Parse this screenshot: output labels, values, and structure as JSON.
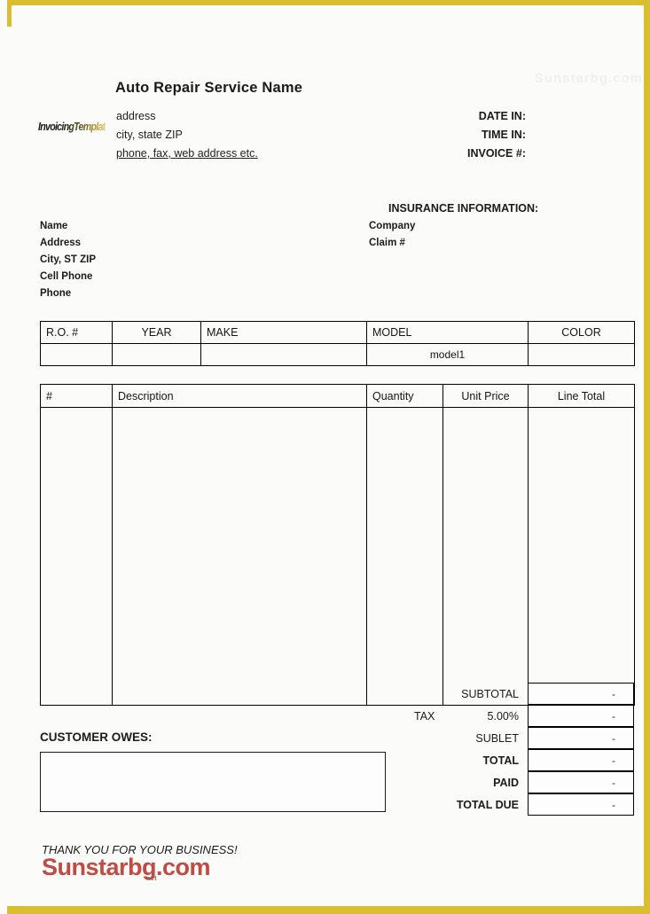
{
  "document": {
    "type": "auto-repair-invoice-template",
    "accent_border_color": "#d9bf2e",
    "watermark_color": "#b9382f",
    "page_background": "#fbfbfa"
  },
  "header": {
    "company_title": "Auto Repair Service Name",
    "brand_logo_text": "InvoicingTemplates",
    "address_line1": "address",
    "address_line2": "city, state ZIP",
    "address_line3": "phone, fax, web address etc.",
    "faint_watermark": "Sunstarbg.com",
    "meta": [
      {
        "label": "DATE IN:",
        "value": ""
      },
      {
        "label": "TIME IN:",
        "value": ""
      },
      {
        "label": "INVOICE #:",
        "value": ""
      }
    ]
  },
  "parties": {
    "customer_fields": [
      "Name",
      "Address",
      "City, ST ZIP",
      "Cell Phone",
      "Phone"
    ],
    "insurance_heading": "INSURANCE INFORMATION:",
    "insurance_fields": [
      "Company",
      "Claim #"
    ]
  },
  "vehicle_table": {
    "headers": [
      "R.O. #",
      "YEAR",
      "MAKE",
      "MODEL",
      "COLOR"
    ],
    "row": [
      "",
      "",
      "",
      "model1",
      ""
    ]
  },
  "items_table": {
    "headers": [
      "#",
      "Description",
      "Quantity",
      "Unit Price",
      "Line Total"
    ],
    "rows": []
  },
  "totals": [
    {
      "tax_label": "",
      "label": "SUBTOTAL",
      "value": "-",
      "bold": false
    },
    {
      "tax_label": "TAX",
      "label": "5.00%",
      "value": "-",
      "bold": false
    },
    {
      "tax_label": "",
      "label": "SUBLET",
      "value": "-",
      "bold": false
    },
    {
      "tax_label": "",
      "label": "TOTAL",
      "value": "-",
      "bold": true
    },
    {
      "tax_label": "",
      "label": "PAID",
      "value": "-",
      "bold": true
    },
    {
      "tax_label": "",
      "label": "TOTAL DUE",
      "value": "-",
      "bold": true
    }
  ],
  "customer_owes": {
    "heading": "CUSTOMER OWES:",
    "value": ""
  },
  "footer": {
    "thank_you": "THANK YOU FOR YOUR BUSINESS!",
    "watermark": "Sunstarbg.com",
    "watermark_sub": "net"
  }
}
